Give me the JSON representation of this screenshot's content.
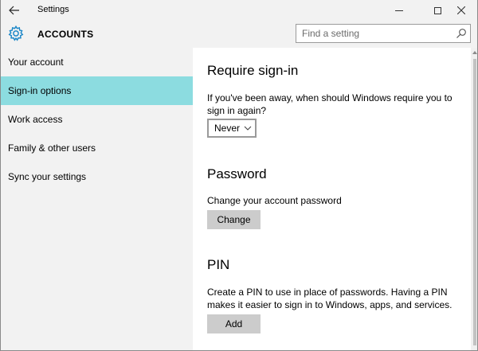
{
  "titlebar": {
    "title": "Settings"
  },
  "header": {
    "section_title": "ACCOUNTS",
    "search_placeholder": "Find a setting"
  },
  "sidebar": {
    "items": [
      {
        "label": "Your account"
      },
      {
        "label": "Sign-in options",
        "active": true
      },
      {
        "label": "Work access"
      },
      {
        "label": "Family & other users"
      },
      {
        "label": "Sync your settings"
      }
    ]
  },
  "content": {
    "require_signin": {
      "heading": "Require sign-in",
      "description": "If you've been away, when should Windows require you to sign in again?",
      "dropdown_value": "Never"
    },
    "password": {
      "heading": "Password",
      "description": "Change your account password",
      "button_label": "Change"
    },
    "pin": {
      "heading": "PIN",
      "description": "Create a PIN to use in place of passwords. Having a PIN makes it easier to sign in to Windows, apps, and services.",
      "button_label": "Add"
    }
  },
  "icons": {
    "back": "back-arrow-icon",
    "settings": "gear-icon",
    "search": "search-icon",
    "minimize": "minimize-icon",
    "maximize": "maximize-icon",
    "close": "close-icon"
  },
  "colors": {
    "accent_selected": "#8cdce0",
    "gear_blue": "#1e88c8",
    "sidebar_bg": "#f2f2f2",
    "button_bg": "#cccccc"
  }
}
